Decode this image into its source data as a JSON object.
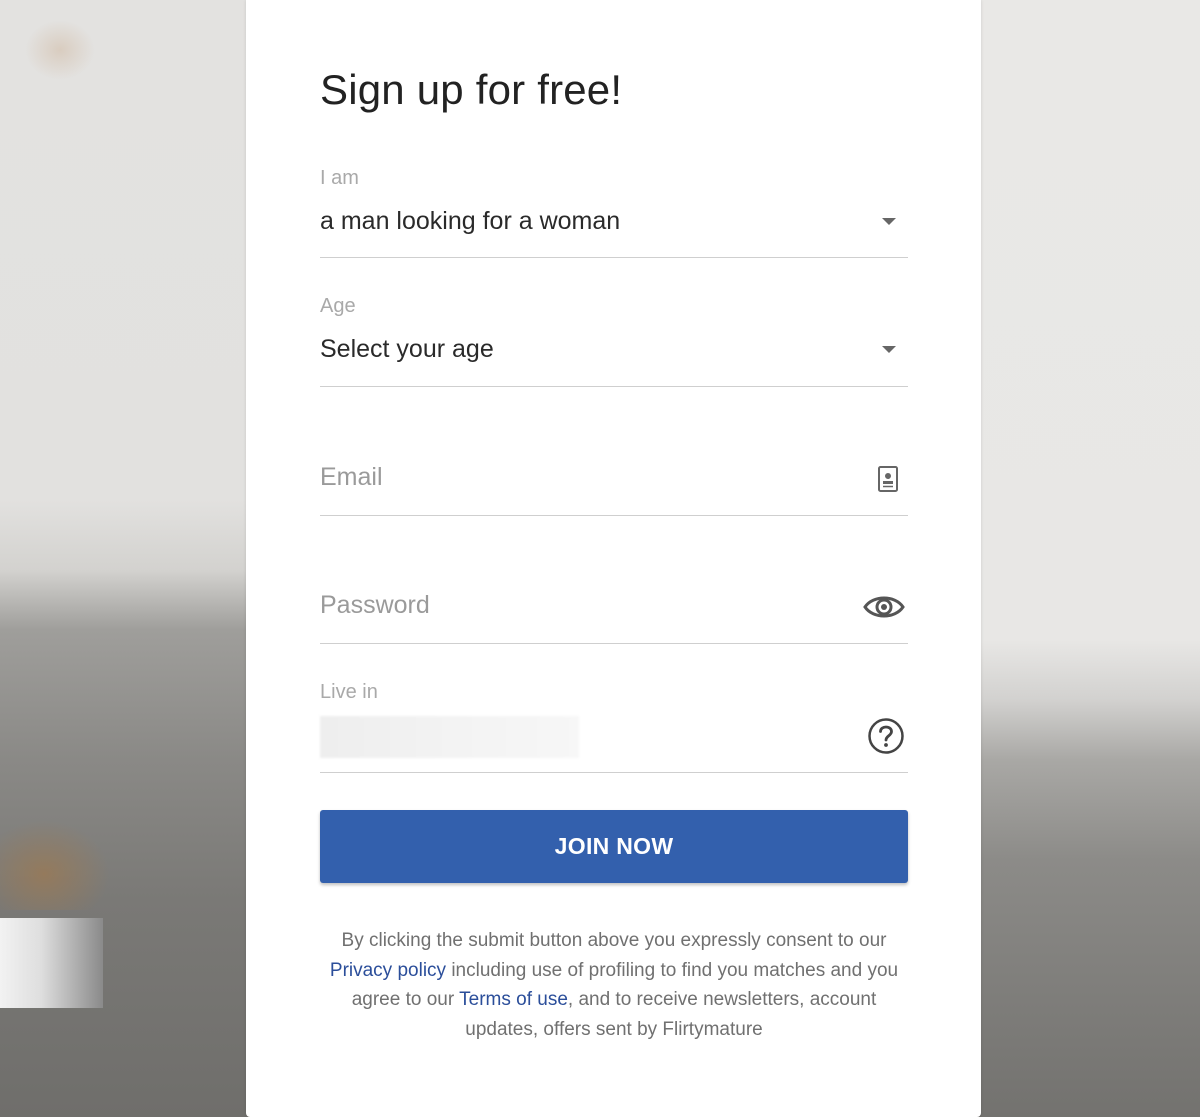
{
  "form": {
    "title": "Sign up for free!",
    "seeking": {
      "label": "I am",
      "value": "a man looking for a woman"
    },
    "age": {
      "label": "Age",
      "value": "Select your age"
    },
    "email": {
      "placeholder": "Email",
      "icon": "contact-card-icon"
    },
    "password": {
      "placeholder": "Password",
      "icon": "eye-icon"
    },
    "location": {
      "label": "Live in",
      "icon": "help-circle-icon"
    },
    "join_label": "JOIN NOW",
    "consent": {
      "part1": "By clicking the submit button above you expressly consent to our ",
      "privacy_link": "Privacy policy",
      "part2": " including use of profiling to find you matches and you agree to our ",
      "terms_link": "Terms of use",
      "part3": ", and to receive newsletters, account updates, offers sent by Flirtymature"
    }
  },
  "colors": {
    "primary_button": "#3360ad",
    "link": "#2b4e9a"
  }
}
